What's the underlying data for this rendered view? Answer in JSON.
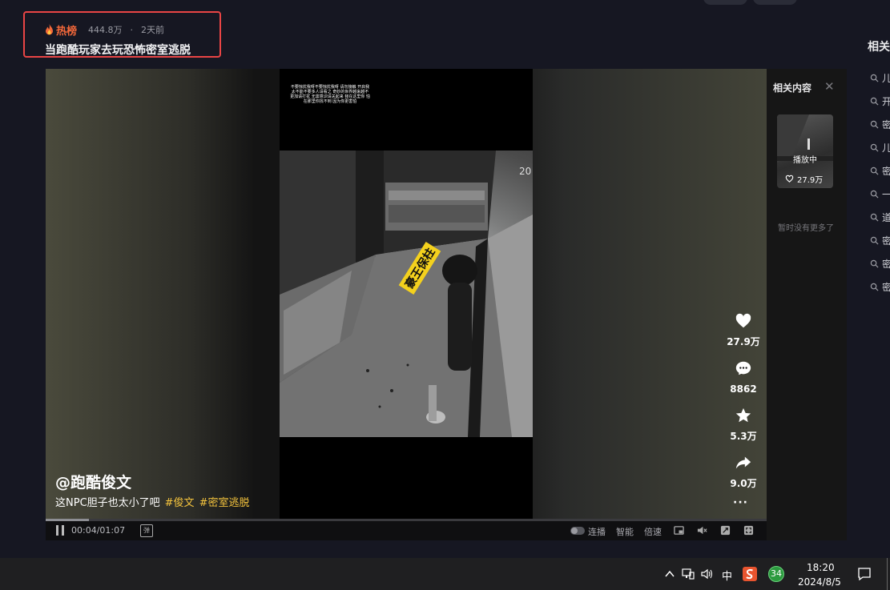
{
  "header": {
    "hot_tag": "热榜",
    "views": "444.8万",
    "separator": "·",
    "posted_ago": "2天前",
    "video_title": "当跑酷玩家去玩恐怖密室逃脱"
  },
  "right_column": {
    "title": "相关",
    "search_items": [
      "儿",
      "开",
      "密",
      "儿",
      "密",
      "一",
      "道",
      "密",
      "密",
      "密"
    ]
  },
  "video": {
    "caption_overlay": "不要惊扰我呀不要惊扰我呀 请勿接触 开启我太不能不要多人请看之 奇妙的世界越来越不 更加请打扰 无需意识请关起来 我在这里你 怕在那里你找不到 因为你更害怕",
    "sticker_text": "豪王保柱",
    "timestamp_fragment": "20",
    "author": "@跑酷俊文",
    "description": "这NPC胆子也太小了吧",
    "tags": [
      "#俊文",
      "#密室逃脱"
    ],
    "actions": {
      "likes": "27.9万",
      "comments": "8862",
      "favorites": "5.3万",
      "shares": "9.0万",
      "more": "···"
    },
    "controls": {
      "time": "00:04/01:07",
      "progress_fraction": 0.06,
      "autoplay": "连播",
      "smart": "智能",
      "speed": "倍速",
      "danmu_icon": "弹"
    }
  },
  "related_panel": {
    "title": "相关内容",
    "close": "✕",
    "thumb_label": "播放中",
    "thumb_likes": "27.9万",
    "empty_text": "暂时没有更多了"
  },
  "taskbar": {
    "ime": "中",
    "badge": "34",
    "time": "18:20",
    "date": "2024/8/5"
  },
  "colors": {
    "hot_accent": "#f4683a",
    "highlight_box": "#e94545",
    "tag_yellow": "#f4c33d"
  }
}
